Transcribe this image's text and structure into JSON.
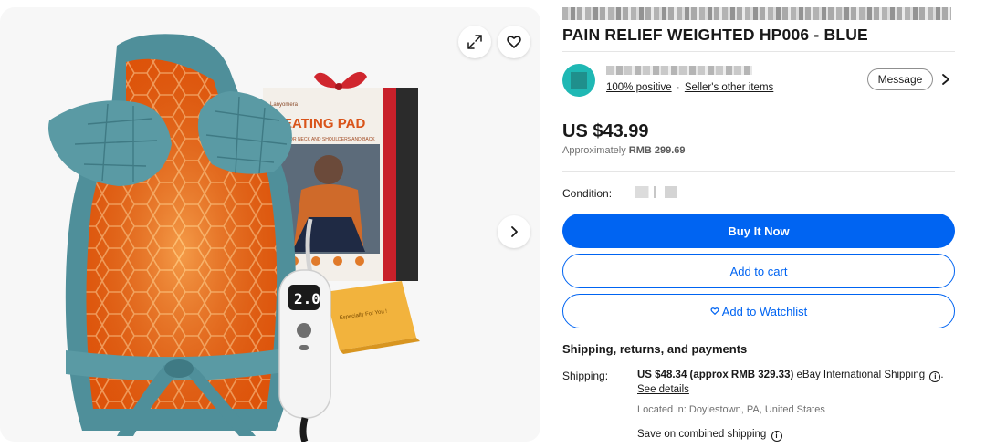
{
  "gallery": {
    "box_brand": "Lanyomera",
    "box_title": "EATING PAD",
    "box_subtitle": "FOR NECK AND SHOULDERS AND BACK",
    "card_text": "Especially For You !",
    "controller_display": "2.0",
    "icons": [
      "expand-icon",
      "heart-icon",
      "chevron-right-icon"
    ]
  },
  "listing": {
    "title": "PAIN RELIEF WEIGHTED HP006 - BLUE"
  },
  "seller": {
    "positive": "100% positive",
    "separator": "·",
    "other_items": "Seller's other items",
    "message_label": "Message"
  },
  "price": {
    "main": "US $43.99",
    "approx_label": "Approximately",
    "approx_value": "RMB 299.69"
  },
  "condition": {
    "label": "Condition:"
  },
  "actions": {
    "buy_now": "Buy It Now",
    "add_to_cart": "Add to cart",
    "watchlist": "Add to Watchlist"
  },
  "shipping": {
    "heading": "Shipping, returns, and payments",
    "label": "Shipping:",
    "cost": "US $48.34 (approx RMB 329.33)",
    "method": "eBay International Shipping",
    "see_details": "See details",
    "located": "Located in: Doylestown, PA, United States",
    "combined": "Save on combined shipping"
  },
  "colors": {
    "primary": "#0064f2",
    "pad_teal": "#4f8f9a",
    "heat_orange": "#e85a10"
  }
}
